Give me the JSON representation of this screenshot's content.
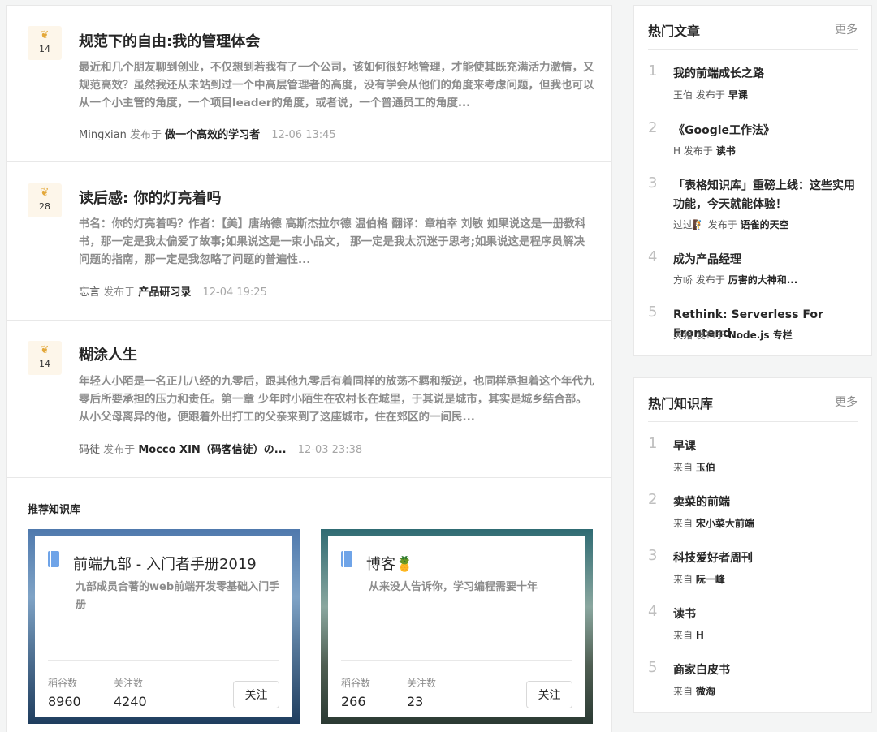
{
  "articles": [
    {
      "likes": "14",
      "title": "规范下的自由:我的管理体会",
      "summary": "最近和几个朋友聊到创业，不仅想到若我有了一个公司，该如何很好地管理，才能使其既充满活力激情，又规范高效？虽然我还从未站到过一个中高层管理者的高度，没有学会从他们的角度来考虑问题，但我也可以从一个小主管的角度，一个项目leader的角度，或者说，一个普通员工的角度...",
      "author": "Mingxian",
      "published_in": "发布于",
      "book": "做一个高效的学习者",
      "time": "12-06 13:45"
    },
    {
      "likes": "28",
      "title": "读后感: 你的灯亮着吗",
      "summary": "书名：你的灯亮着吗？作者：【美】唐纳德 高斯杰拉尔德 温伯格 翻译：章柏幸 刘敏 如果说这是一册教科书，那一定是我太偏爱了故事;如果说这是一束小品文， 那一定是我太沉迷于思考;如果说这是程序员解决问题的指南，那一定是我忽略了问题的普遍性...",
      "author": "忘言",
      "published_in": "发布于",
      "book": "产品研习录",
      "time": "12-04 19:25"
    },
    {
      "likes": "14",
      "title": "糊涂人生",
      "summary": "年轻人小陌是一名正儿八经的九零后，跟其他九零后有着同样的放荡不羁和叛逆，也同样承担着这个年代九零后所要承担的压力和责任。第一章 少年时小陌生在农村长在城里，于其说是城市，其实是城乡结合部。从小父母离异的他，便跟着外出打工的父亲来到了这座城市，住在郊区的一间民...",
      "author": "码徒",
      "published_in": "发布于",
      "book": "Mocco XIN（码客信徒）の...",
      "time": "12-03 23:38"
    }
  ],
  "recommend": {
    "heading": "推荐知识库",
    "cards": [
      {
        "title": "前端九部 - 入门者手册2019",
        "desc": "九部成员合著的web前端开发零基础入门手册",
        "stat1_label": "稻谷数",
        "stat1_value": "8960",
        "stat2_label": "关注数",
        "stat2_value": "4240",
        "follow": "关注"
      },
      {
        "title": "博客🍍",
        "desc": "从来没人告诉你，学习编程需要十年",
        "stat1_label": "稻谷数",
        "stat1_value": "266",
        "stat2_label": "关注数",
        "stat2_value": "23",
        "follow": "关注"
      }
    ]
  },
  "hot_articles": {
    "title": "热门文章",
    "more": "更多",
    "items": [
      {
        "rank": "1",
        "title": "我的前端成长之路",
        "author": "玉伯",
        "via": "发布于",
        "source": "早课"
      },
      {
        "rank": "2",
        "title": "《Google工作法》",
        "author": "H",
        "via": "发布于",
        "source": "读书"
      },
      {
        "rank": "3",
        "title": "「表格知识库」重磅上线：这些实用功能，今天就能体验！",
        "author": "过过🧗",
        "via": "发布于",
        "source": "语雀的天空"
      },
      {
        "rank": "4",
        "title": "成为产品经理",
        "author": "方峤",
        "via": "发布于",
        "source": "厉害的大神和..."
      },
      {
        "rank": "5",
        "title": "Rethink: Serverless For Frontend",
        "author": "天猪",
        "via": "发布于",
        "source": "Node.js 专栏"
      }
    ]
  },
  "hot_books": {
    "title": "热门知识库",
    "more": "更多",
    "items": [
      {
        "rank": "1",
        "title": "早课",
        "via": "来自",
        "source": "玉伯"
      },
      {
        "rank": "2",
        "title": "卖菜的前端",
        "via": "来自",
        "source": "宋小菜大前端"
      },
      {
        "rank": "3",
        "title": "科技爱好者周刊",
        "via": "来自",
        "source": "阮一峰"
      },
      {
        "rank": "4",
        "title": "读书",
        "via": "来自",
        "source": "H"
      },
      {
        "rank": "5",
        "title": "商家白皮书",
        "via": "来自",
        "source": "微淘"
      }
    ]
  },
  "colors": {
    "accent_wheat": "#e3a83b",
    "book_icon": "#6fa4e8"
  }
}
